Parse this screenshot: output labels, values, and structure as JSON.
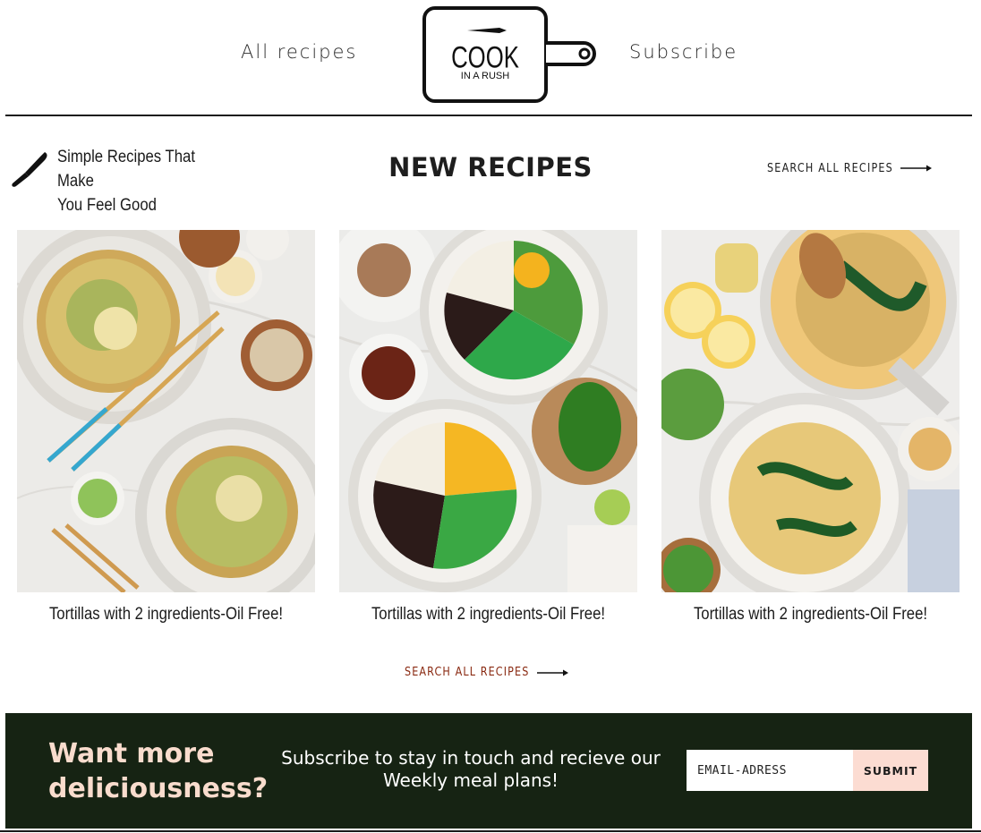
{
  "header": {
    "nav_left": "All recipes",
    "nav_right": "Subscribe",
    "logo": {
      "line1": "COOK",
      "line2": "IN A RUSH"
    }
  },
  "section": {
    "tagline_line1": "Simple Recipes That Make",
    "tagline_line2": "You Feel Good",
    "title": "NEW RECIPES",
    "search_label": "SEARCH ALL RECIPES"
  },
  "cards": [
    {
      "title": "Tortillas with 2 ingredients-Oil Free!",
      "image": "okonomiyaki-plates-photo"
    },
    {
      "title": "Tortillas with 2 ingredients-Oil Free!",
      "image": "rice-bowls-photo"
    },
    {
      "title": "Tortillas with 2 ingredients-Oil Free!",
      "image": "kale-spaghetti-photo"
    }
  ],
  "footer_link": {
    "label": "SEARCH ALL RECIPES"
  },
  "newsletter": {
    "heading_line1": "Want more",
    "heading_line2": "deliciousness?",
    "text_line1": "Subscribe to stay in touch and recieve our",
    "text_line2": "Weekly meal plans!",
    "email_placeholder": "EMAIL-ADRESS",
    "submit_label": "SUBMIT"
  },
  "colors": {
    "band_bg": "#162313",
    "band_heading": "#f9dccd",
    "submit_bg": "#fcdcd2",
    "link_accent": "#8a2a12"
  }
}
